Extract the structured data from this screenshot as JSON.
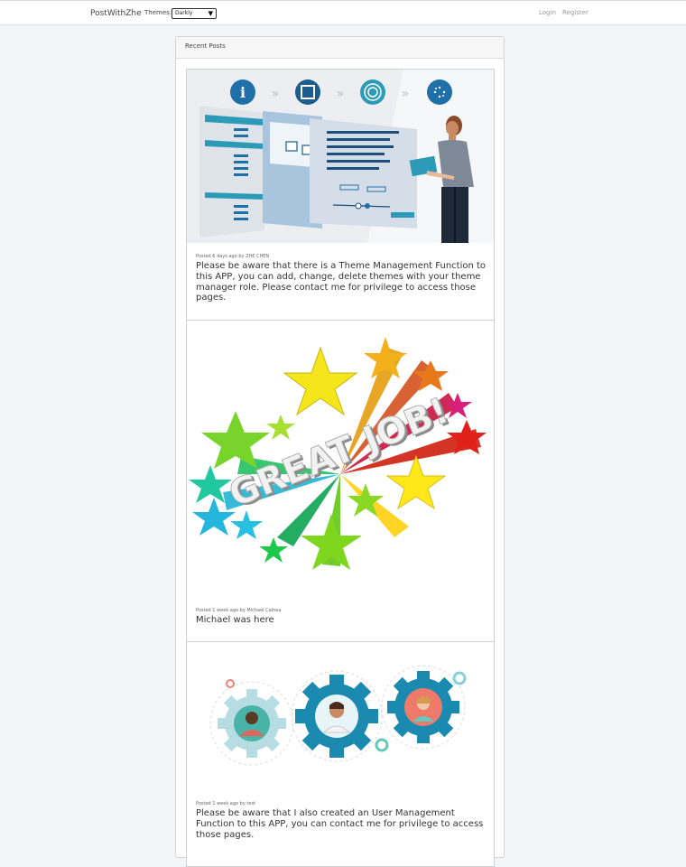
{
  "navbar": {
    "brand": "PostWithZhe",
    "themes_label": "Themes:",
    "theme_selected": "Darkly",
    "login": "Login",
    "register": "Register"
  },
  "card": {
    "header": "Recent Posts"
  },
  "posts": [
    {
      "meta": "Posted 6 days ago by ZHE CHEN",
      "text": "Please be aware that there is a Theme Management Function to this APP, you can add, change, delete themes with your theme manager role. Please contact me for privilege to access those pages.",
      "image": "theme-management-illustration"
    },
    {
      "meta": "Posted 1 week ago by Michael Calnea",
      "text": "Michael was here",
      "image": "great-job-stars-illustration",
      "image_text": "GREAT JOB!"
    },
    {
      "meta": "Posted 1 week ago by test",
      "text": "Please be aware that I also created an User Management Function to this APP, you can contact me for privilege to access those pages.",
      "image": "user-gears-illustration"
    }
  ],
  "colors": {
    "accent_blue": "#1f6fa8",
    "teal": "#2d9bb8"
  }
}
